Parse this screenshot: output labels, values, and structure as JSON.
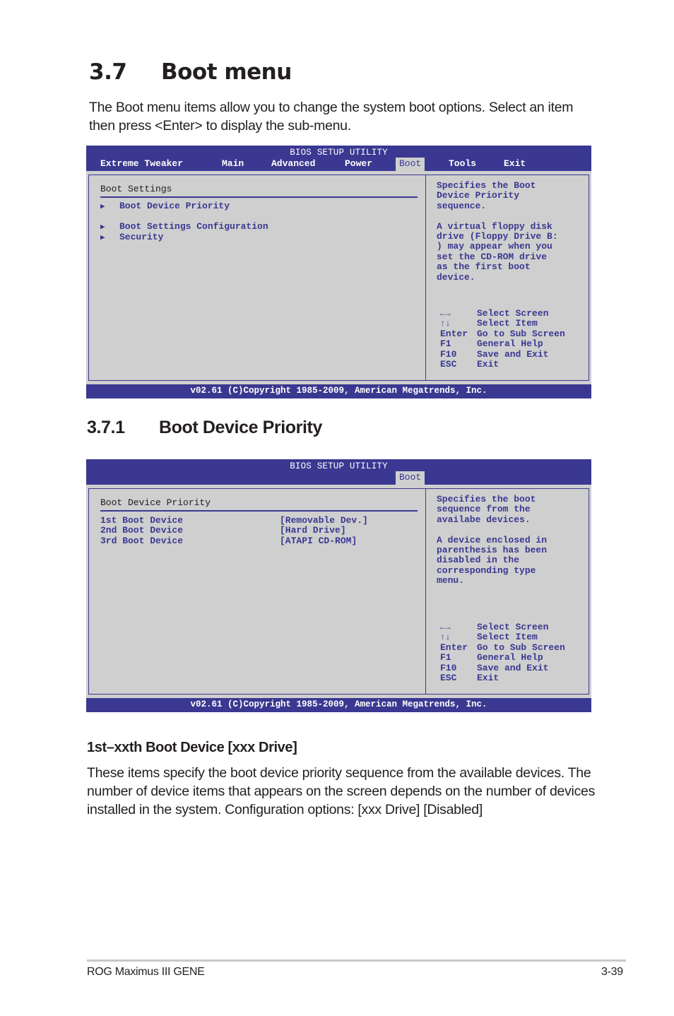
{
  "section": {
    "number": "3.7",
    "title": "Boot menu",
    "intro": "The Boot menu items allow you to change the system boot options. Select an item then press <Enter> to display the sub-menu."
  },
  "bios_boot_menu": {
    "title": "BIOS SETUP UTILITY",
    "tabs": [
      {
        "label": "Extreme Tweaker",
        "active": false
      },
      {
        "label": "Main",
        "active": false
      },
      {
        "label": "Advanced",
        "active": false
      },
      {
        "label": "Power",
        "active": false
      },
      {
        "label": "Boot",
        "active": true
      },
      {
        "label": "Tools",
        "active": false
      },
      {
        "label": "Exit",
        "active": false
      }
    ],
    "panel_heading": "Boot Settings",
    "menu_items": [
      {
        "label": "Boot Device Priority",
        "icon": "triangle-right-icon"
      },
      {
        "label": "Boot Settings Configuration",
        "icon": "triangle-right-icon"
      },
      {
        "label": "Security",
        "icon": "triangle-right-icon"
      }
    ],
    "help_text": "Specifies the Boot\nDevice Priority\nsequence.\n\nA virtual floppy disk\ndrive (Floppy Drive B:\n) may appear when you\nset the CD-ROM drive\nas the first boot\ndevice.",
    "keys": [
      {
        "key": "←→",
        "action": "Select Screen"
      },
      {
        "key": "↑↓",
        "action": "Select Item"
      },
      {
        "key": "Enter",
        "action": "Go to Sub Screen"
      },
      {
        "key": "F1",
        "action": "General Help"
      },
      {
        "key": "F10",
        "action": "Save and Exit"
      },
      {
        "key": "ESC",
        "action": "Exit"
      }
    ],
    "footer": "v02.61 (C)Copyright 1985-2009, American Megatrends, Inc."
  },
  "subsection": {
    "number": "3.7.1",
    "title": "Boot Device Priority"
  },
  "bios_boot_priority": {
    "title": "BIOS SETUP UTILITY",
    "active_tab": "Boot",
    "panel_heading": "Boot Device Priority",
    "devices": [
      {
        "label": "1st Boot Device",
        "value": "[Removable Dev.]"
      },
      {
        "label": "2nd Boot Device",
        "value": "[Hard Drive]"
      },
      {
        "label": "3rd Boot Device",
        "value": "[ATAPI CD-ROM]"
      }
    ],
    "help_text": "Specifies the boot\nsequence from the\navailabe devices.\n\nA device enclosed in\nparenthesis has been\ndisabled in the\ncorresponding type\nmenu.",
    "keys": [
      {
        "key": "←→",
        "action": "Select Screen"
      },
      {
        "key": "↑↓",
        "action": "Select Item"
      },
      {
        "key": "Enter",
        "action": "Go to Sub Screen"
      },
      {
        "key": "F1",
        "action": "General Help"
      },
      {
        "key": "F10",
        "action": "Save and Exit"
      },
      {
        "key": "ESC",
        "action": "Exit"
      }
    ],
    "footer": "v02.61 (C)Copyright 1985-2009, American Megatrends, Inc."
  },
  "item_description": {
    "heading": "1st–xxth Boot Device [xxx Drive]",
    "body": "These items specify the boot device priority sequence from the available devices. The number of device items that appears on the screen depends on the number of devices installed in the system. Configuration options: [xxx Drive] [Disabled]"
  },
  "page_footer": {
    "product": "ROG Maximus III GENE",
    "page": "3-39"
  },
  "colors": {
    "bios_blue": "#3a3891",
    "bios_gray": "#cfcfcf",
    "text_dark": "#231f20"
  }
}
